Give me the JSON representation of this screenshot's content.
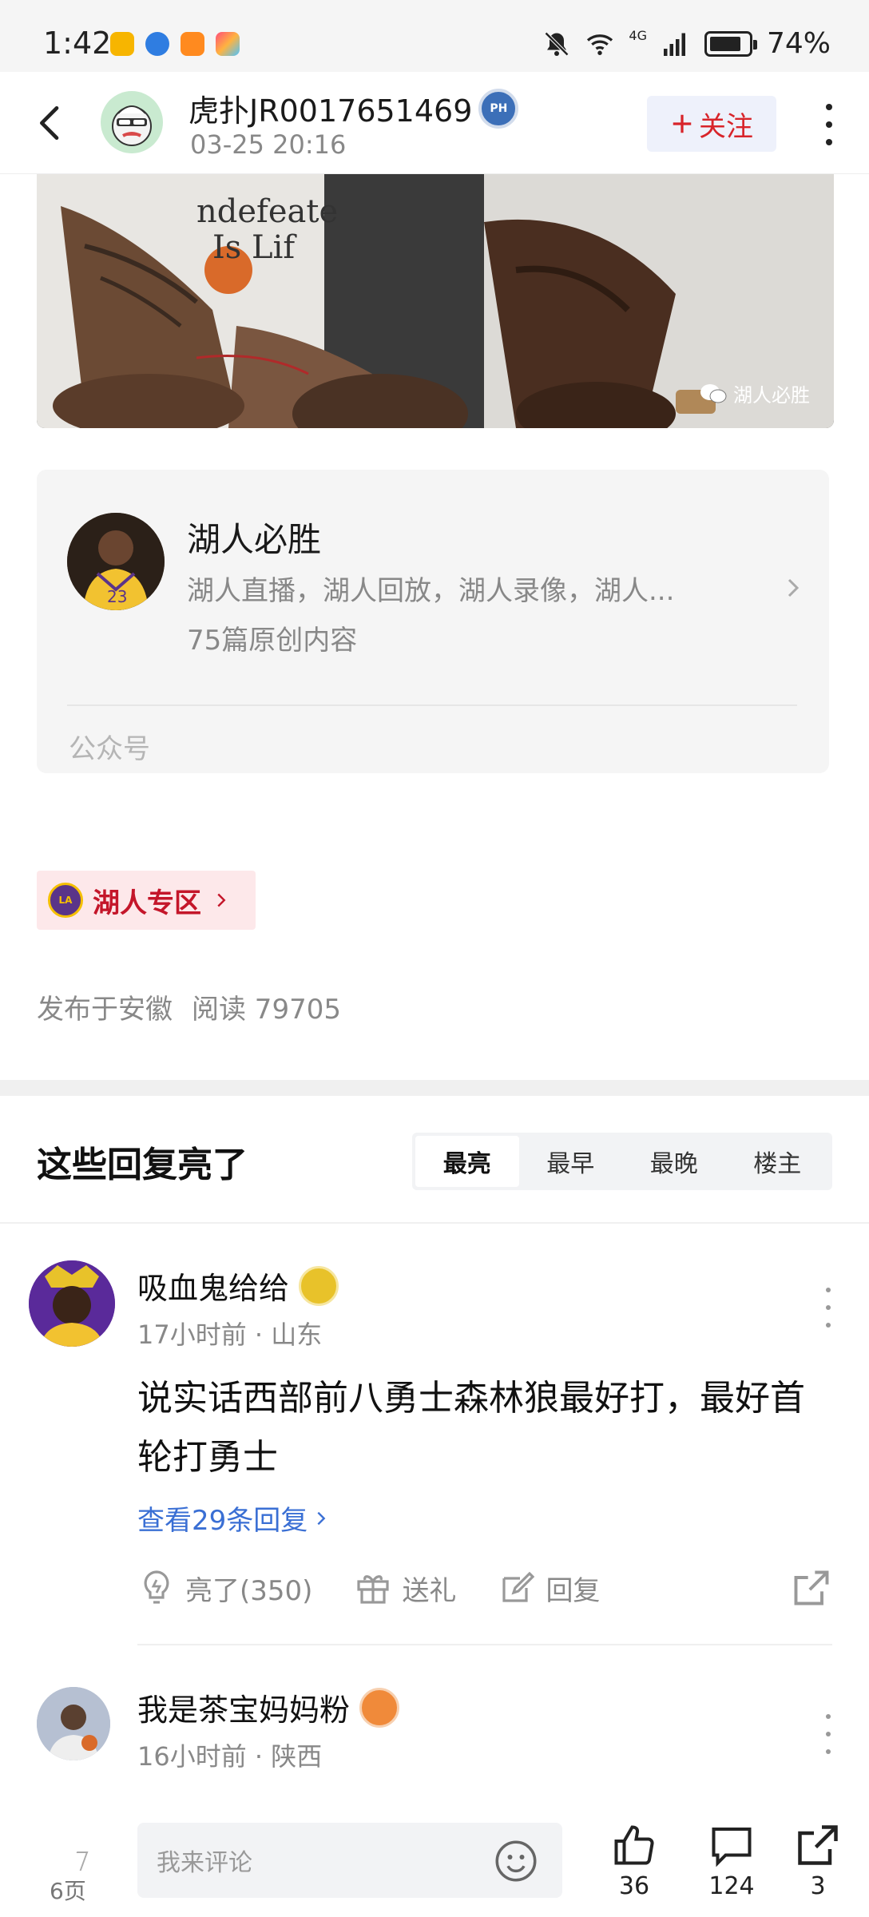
{
  "status_bar": {
    "time": "1:42",
    "network": "4G",
    "battery": "74%"
  },
  "header": {
    "username": "虎扑JR0017651469",
    "badge_text": "PH",
    "post_time": "03-25 20:16",
    "follow_label": "关注"
  },
  "article_image": {
    "watermark": "湖人必胜",
    "shirt_text_1": "ndefeate",
    "shirt_text_2": "Is Lif"
  },
  "official_account": {
    "name": "湖人必胜",
    "description": "湖人直播，湖人回放，湖人录像，湖人...",
    "count_text": "75篇原创内容",
    "type_label": "公众号",
    "jersey_number": "23"
  },
  "zone": {
    "logo_text": "LA",
    "label": "湖人专区"
  },
  "post_meta": {
    "location": "发布于安徽",
    "reads": "阅读 79705"
  },
  "replies": {
    "title": "这些回复亮了",
    "sort_tabs": [
      "最亮",
      "最早",
      "最晚",
      "楼主"
    ],
    "active_tab": "最亮"
  },
  "comments": [
    {
      "username": "吸血鬼给给",
      "meta": "17小时前 · 山东",
      "text": "说实话西部前八勇士森林狼最好打，最好首轮打勇士",
      "replies_link": "查看29条回复",
      "actions": {
        "light": "亮了(350)",
        "gift": "送礼",
        "reply": "回复"
      }
    },
    {
      "username": "我是茶宝妈妈粉",
      "meta": "16小时前 · 陕西"
    }
  ],
  "bottom_bar": {
    "page": "6页",
    "input_placeholder": "我来评论",
    "likes": "36",
    "comments": "124",
    "shares": "3"
  },
  "colors": {
    "accent_red": "#d8242a",
    "link_blue": "#3a6fd4",
    "lakers_purple": "#5a3489",
    "lakers_gold": "#f5c000"
  }
}
